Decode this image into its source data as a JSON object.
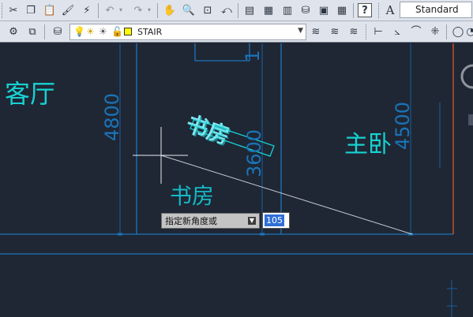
{
  "toolbar_top": {
    "text_style": "Standard",
    "icons": [
      "cut-icon",
      "copy-icon",
      "paste-icon",
      "match-properties-icon",
      "block-editor-icon",
      "undo-icon",
      "undo-dropdown-icon",
      "redo-icon",
      "redo-dropdown-icon",
      "pan-icon",
      "zoom-realtime-icon",
      "zoom-window-icon",
      "zoom-previous-icon",
      "properties-icon",
      "design-center-icon",
      "tool-palettes-icon",
      "sheet-set-icon",
      "markup-icon",
      "calculator-icon",
      "help-icon",
      "text-style-icon"
    ]
  },
  "layer_toolbar": {
    "current_layer": "STAIR",
    "layer_color": "#ffff00",
    "dim_icons": [
      "linear-dimension-icon",
      "aligned-dimension-icon",
      "arc-length-icon",
      "ordinate-dimension-icon",
      "radius-dimension-icon"
    ]
  },
  "drawing": {
    "room_labels": {
      "living_room": "客厅",
      "study_upper": "书房",
      "study_rotated": "书房",
      "study_lower": "书房",
      "master_bedroom": "主卧"
    },
    "dimensions": {
      "left": "4800",
      "middle": "3600",
      "right": "4500",
      "top": "1"
    },
    "colors": {
      "background": "#1f2734",
      "room_text": "#17d2d2",
      "dimension": "#1a74b8",
      "red_line": "#e0542f"
    }
  },
  "dynamic_input": {
    "prompt": "指定新角度或",
    "value": "105"
  }
}
